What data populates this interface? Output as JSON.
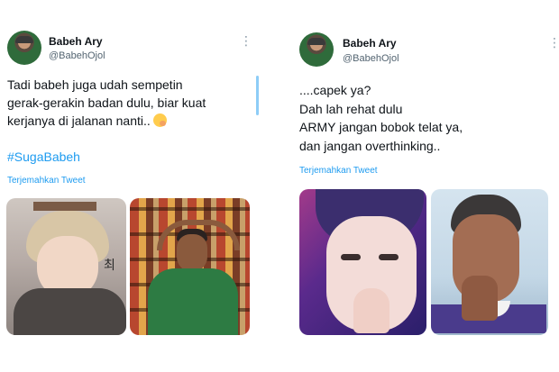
{
  "left_tweet": {
    "name": "Babeh Ary",
    "handle": "@BabehOjol",
    "lines": [
      "Tadi babeh juga udah sempetin",
      "gerak-gerakin badan dulu, biar kuat",
      "kerjanya di jalanan nanti.."
    ],
    "emoji": "hand-over-mouth-emoji",
    "hashtag": "#SugaBabeh",
    "translate": "Terjemahkan Tweet",
    "photo2_sign": "최"
  },
  "right_tweet": {
    "name": "Babeh Ary",
    "handle": "@BabehOjol",
    "lines": [
      "....capek ya?",
      "Dah lah rehat dulu",
      "ARMY jangan bobok telat ya,",
      "dan jangan overthinking.."
    ],
    "translate": "Terjemahkan Tweet"
  },
  "colors": {
    "link": "#1d9bf0",
    "text": "#0f1419",
    "secondary": "#536471"
  }
}
